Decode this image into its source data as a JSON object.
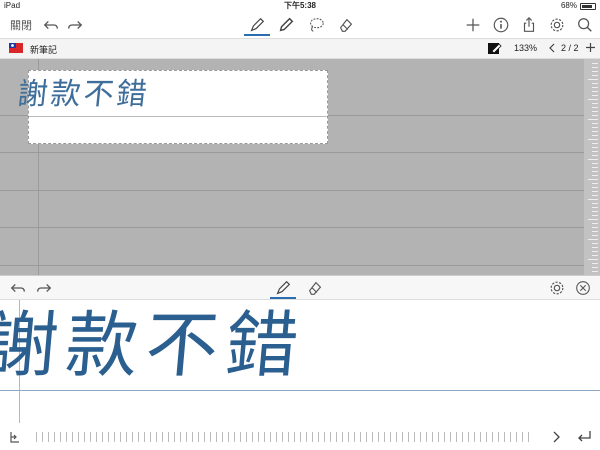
{
  "status": {
    "device": "iPad",
    "time": "下午5:38",
    "battery": "68%"
  },
  "toolbar": {
    "close_label": "關閉"
  },
  "notebook": {
    "title": "新筆記",
    "zoom": "133%",
    "page": "2 / 2"
  },
  "handwriting": {
    "text": "謝款不錯"
  },
  "colors": {
    "accent": "#2a6db0",
    "ink": "#2a5f8f",
    "canvas": "#b3b3b3"
  },
  "icons": [
    "undo-icon",
    "redo-icon",
    "pen-icon",
    "pencil-icon",
    "lasso-icon",
    "eraser-icon",
    "plus-icon",
    "info-icon",
    "share-icon",
    "gear-icon",
    "search-icon",
    "flag-icon",
    "highlighter-icon",
    "chevron-left-icon",
    "chevron-right-icon",
    "close-circle-icon",
    "return-icon",
    "space-icon"
  ]
}
